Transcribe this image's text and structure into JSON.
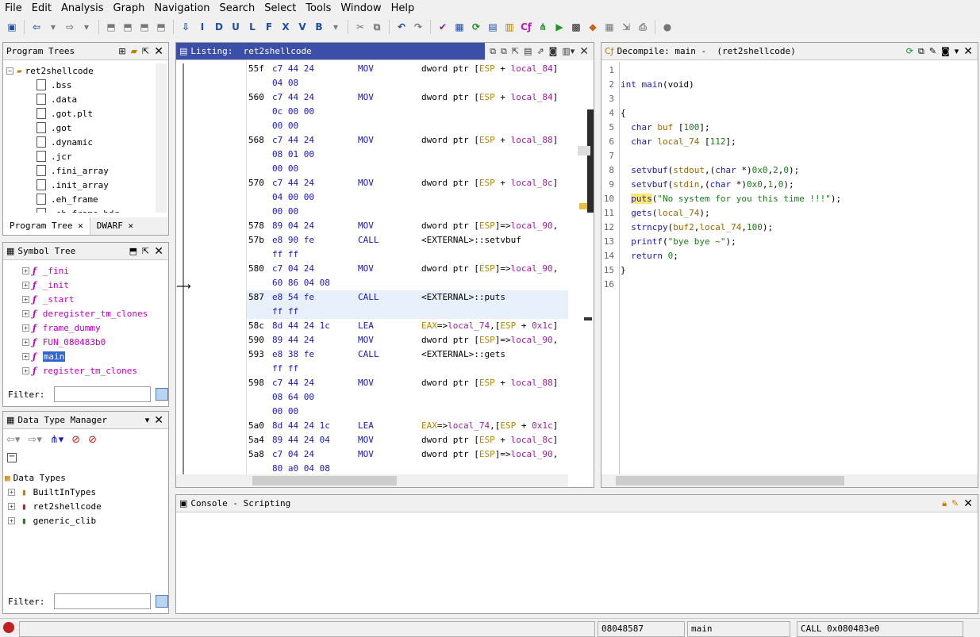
{
  "menu": [
    "File",
    "Edit",
    "Analysis",
    "Graph",
    "Navigation",
    "Search",
    "Select",
    "Tools",
    "Window",
    "Help"
  ],
  "program_trees": {
    "title": "Program Trees",
    "root": "ret2shellcode",
    "items": [
      ".bss",
      ".data",
      ".got.plt",
      ".got",
      ".dynamic",
      ".jcr",
      ".fini_array",
      ".init_array",
      ".eh_frame",
      ".eh_frame_hdr"
    ],
    "tabs": [
      "Program Tree",
      "DWARF"
    ]
  },
  "symbol_tree": {
    "title": "Symbol Tree",
    "items": [
      "_fini",
      "_init",
      "_start",
      "deregister_tm_clones",
      "frame_dummy",
      "FUN_080483b0",
      "main",
      "register_tm_clones"
    ],
    "selected": "main",
    "filter_label": "Filter:"
  },
  "data_type_manager": {
    "title": "Data Type Manager",
    "root": "Data Types",
    "items": [
      "BuiltInTypes",
      "ret2shellcode",
      "generic_clib"
    ],
    "filter_label": "Filter:"
  },
  "listing": {
    "title": "Listing:  ret2shellcode",
    "rows": [
      {
        "addr": "55f",
        "bytes": "c7 44 24",
        "mn": "MOV",
        "op": [
          [
            "",
            "dword ptr ["
          ],
          [
            "g",
            "ESP"
          ],
          [
            "",
            " + "
          ],
          [
            "p",
            "local_84"
          ],
          [
            "",
            "]"
          ]
        ]
      },
      {
        "addr": "",
        "bytes": "04 08",
        "mn": "",
        "op": []
      },
      {
        "addr": "560",
        "bytes": "c7 44 24",
        "mn": "MOV",
        "op": [
          [
            "",
            "dword ptr ["
          ],
          [
            "g",
            "ESP"
          ],
          [
            "",
            " + "
          ],
          [
            "p",
            "local_84"
          ],
          [
            "",
            "]"
          ]
        ]
      },
      {
        "addr": "",
        "bytes": "0c 00 00",
        "mn": "",
        "op": []
      },
      {
        "addr": "",
        "bytes": "00 00",
        "mn": "",
        "op": []
      },
      {
        "addr": "568",
        "bytes": "c7 44 24",
        "mn": "MOV",
        "op": [
          [
            "",
            "dword ptr ["
          ],
          [
            "g",
            "ESP"
          ],
          [
            "",
            " + "
          ],
          [
            "p",
            "local_88"
          ],
          [
            "",
            "]"
          ]
        ]
      },
      {
        "addr": "",
        "bytes": "08 01 00",
        "mn": "",
        "op": []
      },
      {
        "addr": "",
        "bytes": "00 00",
        "mn": "",
        "op": []
      },
      {
        "addr": "570",
        "bytes": "c7 44 24",
        "mn": "MOV",
        "op": [
          [
            "",
            "dword ptr ["
          ],
          [
            "g",
            "ESP"
          ],
          [
            "",
            " + "
          ],
          [
            "p",
            "local_8c"
          ],
          [
            "",
            "]"
          ]
        ]
      },
      {
        "addr": "",
        "bytes": "04 00 00",
        "mn": "",
        "op": []
      },
      {
        "addr": "",
        "bytes": "00 00",
        "mn": "",
        "op": []
      },
      {
        "addr": "578",
        "bytes": "89 04 24",
        "mn": "MOV",
        "op": [
          [
            "",
            "dword ptr ["
          ],
          [
            "g",
            "ESP"
          ],
          [
            "",
            "]=>"
          ],
          [
            "p",
            "local_90"
          ],
          [
            "",
            ","
          ]
        ]
      },
      {
        "addr": "57b",
        "bytes": "e8 90 fe",
        "mn": "CALL",
        "op": [
          [
            "",
            "<EXTERNAL>::setvbuf"
          ]
        ]
      },
      {
        "addr": "",
        "bytes": "ff ff",
        "mn": "",
        "op": []
      },
      {
        "addr": "580",
        "bytes": "c7 04 24",
        "mn": "MOV",
        "op": [
          [
            "",
            "dword ptr ["
          ],
          [
            "g",
            "ESP"
          ],
          [
            "",
            "]=>"
          ],
          [
            "p",
            "local_90"
          ],
          [
            "",
            ","
          ]
        ]
      },
      {
        "addr": "",
        "bytes": "60 86 04 08",
        "mn": "",
        "op": []
      },
      {
        "addr": "587",
        "bytes": "e8 54 fe",
        "mn": "CALL",
        "op": [
          [
            "",
            "<EXTERNAL>::puts"
          ]
        ]
      },
      {
        "addr": "",
        "bytes": "ff ff",
        "mn": "",
        "op": []
      },
      {
        "addr": "58c",
        "bytes": "8d 44 24 1c",
        "mn": "LEA",
        "op": [
          [
            "g",
            "EAX"
          ],
          [
            "",
            "=>"
          ],
          [
            "p",
            "local_74"
          ],
          [
            "",
            ",["
          ],
          [
            "g",
            "ESP"
          ],
          [
            "",
            " + "
          ],
          [
            "p",
            "0x1c"
          ],
          [
            "",
            "]"
          ]
        ]
      },
      {
        "addr": "590",
        "bytes": "89 44 24",
        "mn": "MOV",
        "op": [
          [
            "",
            "dword ptr ["
          ],
          [
            "g",
            "ESP"
          ],
          [
            "",
            "]=>"
          ],
          [
            "p",
            "local_90"
          ],
          [
            "",
            ","
          ]
        ]
      },
      {
        "addr": "593",
        "bytes": "e8 38 fe",
        "mn": "CALL",
        "op": [
          [
            "",
            "<EXTERNAL>::gets"
          ]
        ]
      },
      {
        "addr": "",
        "bytes": "ff ff",
        "mn": "",
        "op": []
      },
      {
        "addr": "598",
        "bytes": "c7 44 24",
        "mn": "MOV",
        "op": [
          [
            "",
            "dword ptr ["
          ],
          [
            "g",
            "ESP"
          ],
          [
            "",
            " + "
          ],
          [
            "p",
            "local_88"
          ],
          [
            "",
            "]"
          ]
        ]
      },
      {
        "addr": "",
        "bytes": "08 64 00",
        "mn": "",
        "op": []
      },
      {
        "addr": "",
        "bytes": "00 00",
        "mn": "",
        "op": []
      },
      {
        "addr": "5a0",
        "bytes": "8d 44 24 1c",
        "mn": "LEA",
        "op": [
          [
            "g",
            "EAX"
          ],
          [
            "",
            "=>"
          ],
          [
            "p",
            "local_74"
          ],
          [
            "",
            ",["
          ],
          [
            "g",
            "ESP"
          ],
          [
            "",
            " + "
          ],
          [
            "p",
            "0x1c"
          ],
          [
            "",
            "]"
          ]
        ]
      },
      {
        "addr": "5a4",
        "bytes": "89 44 24 04",
        "mn": "MOV",
        "op": [
          [
            "",
            "dword ptr ["
          ],
          [
            "g",
            "ESP"
          ],
          [
            "",
            " + "
          ],
          [
            "p",
            "local_8c"
          ],
          [
            "",
            "]"
          ]
        ]
      },
      {
        "addr": "5a8",
        "bytes": "c7 04 24",
        "mn": "MOV",
        "op": [
          [
            "",
            "dword ptr ["
          ],
          [
            "g",
            "ESP"
          ],
          [
            "",
            "]=>"
          ],
          [
            "p",
            "local_90"
          ],
          [
            "",
            ","
          ]
        ]
      },
      {
        "addr": "",
        "bytes": "80 a0 04 08",
        "mn": "",
        "op": []
      }
    ]
  },
  "decompile": {
    "title": "Decompile: main -  (ret2shellcode)",
    "lines": [
      [],
      [
        [
          "k",
          "int "
        ],
        [
          "f",
          "main"
        ],
        [
          "",
          "(void)"
        ]
      ],
      [],
      [
        [
          "",
          "{"
        ]
      ],
      [
        [
          "",
          "  "
        ],
        [
          "k",
          "char "
        ],
        [
          "v",
          "buf"
        ],
        [
          "",
          " ["
        ],
        [
          "n",
          "100"
        ],
        [
          "",
          "];"
        ]
      ],
      [
        [
          "",
          "  "
        ],
        [
          "k",
          "char "
        ],
        [
          "v",
          "local_74"
        ],
        [
          "",
          " ["
        ],
        [
          "n",
          "112"
        ],
        [
          "",
          "];"
        ]
      ],
      [],
      [
        [
          "",
          "  "
        ],
        [
          "f",
          "setvbuf"
        ],
        [
          "",
          "("
        ],
        [
          "v",
          "stdout"
        ],
        [
          "",
          ",("
        ],
        [
          "k",
          "char"
        ],
        [
          "",
          " *)"
        ],
        [
          "n",
          "0x0"
        ],
        [
          "",
          ","
        ],
        [
          "n",
          "2"
        ],
        [
          "",
          ","
        ],
        [
          "n",
          "0"
        ],
        [
          "",
          ");"
        ]
      ],
      [
        [
          "",
          "  "
        ],
        [
          "f",
          "setvbuf"
        ],
        [
          "",
          "("
        ],
        [
          "v",
          "stdin"
        ],
        [
          "",
          ",("
        ],
        [
          "k",
          "char"
        ],
        [
          "",
          " *)"
        ],
        [
          "n",
          "0x0"
        ],
        [
          "",
          ","
        ],
        [
          "n",
          "1"
        ],
        [
          "",
          ","
        ],
        [
          "n",
          "0"
        ],
        [
          "",
          ");"
        ]
      ],
      [
        [
          "",
          "  "
        ],
        [
          "f",
          "puts"
        ],
        [
          "",
          "("
        ],
        [
          "s",
          "\"No system for you this time !!!\""
        ],
        [
          "",
          ");"
        ]
      ],
      [
        [
          "",
          "  "
        ],
        [
          "f",
          "gets"
        ],
        [
          "",
          "("
        ],
        [
          "v",
          "local_74"
        ],
        [
          "",
          ");"
        ]
      ],
      [
        [
          "",
          "  "
        ],
        [
          "f",
          "strncpy"
        ],
        [
          "",
          "("
        ],
        [
          "v",
          "buf2"
        ],
        [
          "",
          ","
        ],
        [
          "v",
          "local_74"
        ],
        [
          "",
          ","
        ],
        [
          "n",
          "100"
        ],
        [
          "",
          ");"
        ]
      ],
      [
        [
          "",
          "  "
        ],
        [
          "f",
          "printf"
        ],
        [
          "",
          "("
        ],
        [
          "s",
          "\"bye bye ~\""
        ],
        [
          "",
          ");"
        ]
      ],
      [
        [
          "",
          "  "
        ],
        [
          "k",
          "return "
        ],
        [
          "n",
          "0"
        ],
        [
          "",
          ";"
        ]
      ],
      [
        [
          "",
          "}"
        ]
      ],
      []
    ]
  },
  "console": {
    "title": "Console - Scripting"
  },
  "status": {
    "addr": "08048587",
    "func": "main",
    "instr": "CALL 0x080483e0"
  },
  "colors": {
    "panel_title_active": "#3c4fa8",
    "selected": "#3366cc"
  }
}
